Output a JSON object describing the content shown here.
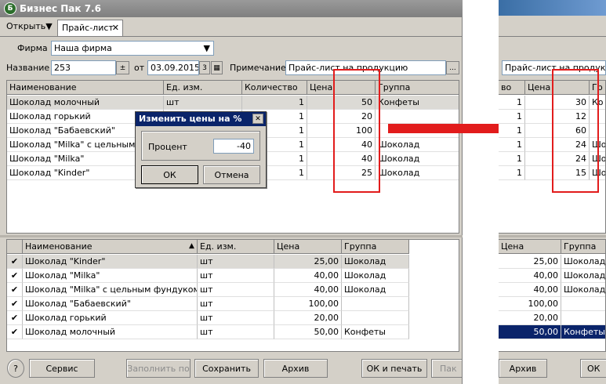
{
  "window": {
    "title": "Бизнес Пак 7.6",
    "logo": "Б"
  },
  "menu": {
    "open": "Открыть",
    "tab": "Прайс-лист",
    "tab_close": "✕"
  },
  "form": {
    "firm_label": "Фирма",
    "firm_value": "Наша фирма",
    "name_label": "Название",
    "name_value": "253",
    "from_label": "от",
    "date_value": "03.09.2015",
    "note_label": "Примечание",
    "note_value": "Прайс-лист на продукцию",
    "dots": "..."
  },
  "top_grid": {
    "headers": [
      "Наименование",
      "Ед. изм.",
      "Количество",
      "Цена",
      "Группа"
    ],
    "rows": [
      [
        "Шоколад молочный",
        "шт",
        "1",
        "50",
        "Конфеты"
      ],
      [
        "Шоколад горький",
        "шт",
        "1",
        "20",
        ""
      ],
      [
        "Шоколад \"Бабаевский\"",
        "шт",
        "1",
        "100",
        ""
      ],
      [
        "Шоколад \"Milka\" с цельным фундуком",
        "шт",
        "1",
        "40",
        "Шоколад"
      ],
      [
        "Шоколад \"Milka\"",
        "шт",
        "1",
        "40",
        "Шоколад"
      ],
      [
        "Шоколад \"Kinder\"",
        "шт",
        "1",
        "25",
        "Шоколад"
      ]
    ]
  },
  "dialog": {
    "title": "Изменить цены на %",
    "close": "✕",
    "label": "Процент",
    "value": "-40",
    "ok": "ОК",
    "cancel": "Отмена"
  },
  "bottom_grid": {
    "headers": [
      "Наименование",
      "Ед. изм.",
      "Цена",
      "Группа"
    ],
    "sort_mark": "▲",
    "check": "✔",
    "rows": [
      [
        "Шоколад \"Kinder\"",
        "шт",
        "25,00",
        "Шоколад"
      ],
      [
        "Шоколад \"Milka\"",
        "шт",
        "40,00",
        "Шоколад"
      ],
      [
        "Шоколад \"Milka\" с цельным фундуком",
        "шт",
        "40,00",
        "Шоколад"
      ],
      [
        "Шоколад \"Бабаевский\"",
        "шт",
        "100,00",
        ""
      ],
      [
        "Шоколад горький",
        "шт",
        "20,00",
        ""
      ],
      [
        "Шоколад молочный",
        "шт",
        "50,00",
        "Конфеты"
      ]
    ]
  },
  "buttons": {
    "help": "?",
    "service": "Сервис",
    "fill": "Заполнить по",
    "save": "Сохранить",
    "archive": "Архив",
    "ok_print": "ОК и печать",
    "cut": "Пак"
  },
  "right_snippet": {
    "note": "Прайс-лист на продукции",
    "top_headers": [
      "во",
      "Цена",
      "Гр"
    ],
    "top_qty": [
      "1",
      "1",
      "1",
      "1",
      "1",
      "1"
    ],
    "top_prices": [
      "30",
      "12",
      "60",
      "24",
      "24",
      "15"
    ],
    "top_group": [
      "Ко",
      "",
      "",
      "Шо",
      "Шо",
      "Шо"
    ],
    "bottom_headers": [
      "Цена",
      "Группа"
    ],
    "bottom_rows": [
      [
        "25,00",
        "Шоколад"
      ],
      [
        "40,00",
        "Шоколад"
      ],
      [
        "40,00",
        "Шоколад"
      ],
      [
        "100,00",
        ""
      ],
      [
        "20,00",
        ""
      ],
      [
        "50,00",
        "Конфеты"
      ]
    ],
    "archive": "Архив",
    "ok": "ОК"
  },
  "colors": {
    "highlight": "#e21c1c",
    "arrow": "#e21c1c",
    "selection": "#0a246a"
  }
}
